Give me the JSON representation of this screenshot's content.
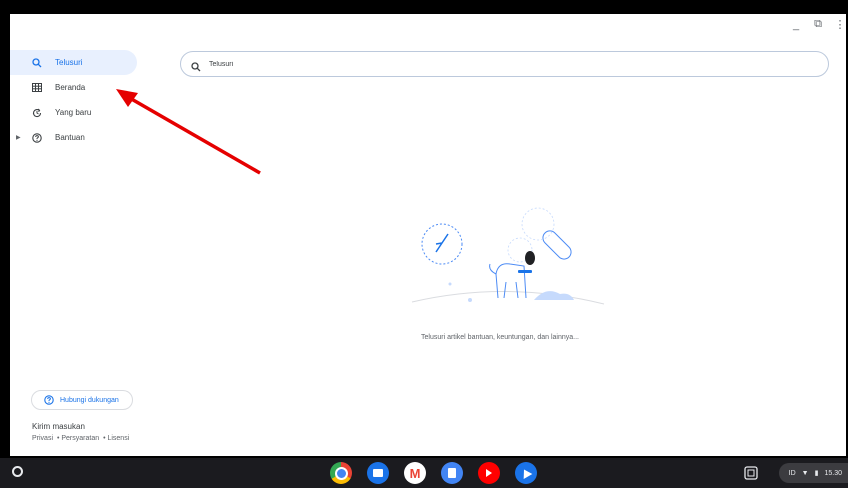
{
  "window": {
    "controls": {
      "minimize": "_",
      "restore": "⧉",
      "close": "⋮"
    }
  },
  "sidebar": {
    "items": [
      {
        "label": "Telusuri",
        "icon": "search-icon",
        "active": true
      },
      {
        "label": "Beranda",
        "icon": "grid-icon",
        "active": false
      },
      {
        "label": "Yang baru",
        "icon": "update-icon",
        "active": false
      },
      {
        "label": "Bantuan",
        "icon": "help-icon",
        "active": false,
        "expandable": true
      }
    ],
    "support_button": "Hubungi dukungan",
    "feedback": "Kirim masukan",
    "legal": {
      "privacy": "Privasi",
      "terms": "• Persyaratan",
      "licenses": "• Lisensi"
    }
  },
  "search": {
    "placeholder": "Telusuri"
  },
  "empty_state": {
    "text": "Telusuri artikel bantuan, keuntungan, dan lainnya..."
  },
  "annotation": {
    "arrow_color": "#e50000"
  },
  "shelf": {
    "apps": [
      {
        "name": "chrome-icon",
        "color": "#4285f4"
      },
      {
        "name": "files-icon",
        "color": "#1a73e8"
      },
      {
        "name": "gmail-icon",
        "color": "#ea4335"
      },
      {
        "name": "docs-icon",
        "color": "#4285f4"
      },
      {
        "name": "youtube-icon",
        "color": "#ff0000"
      },
      {
        "name": "pointer-icon",
        "color": "#1a73e8"
      }
    ],
    "tray": {
      "ime": "ID",
      "time": "15.30"
    }
  },
  "colors": {
    "accent": "#1a73e8",
    "active_bg": "#e8f0fe"
  }
}
